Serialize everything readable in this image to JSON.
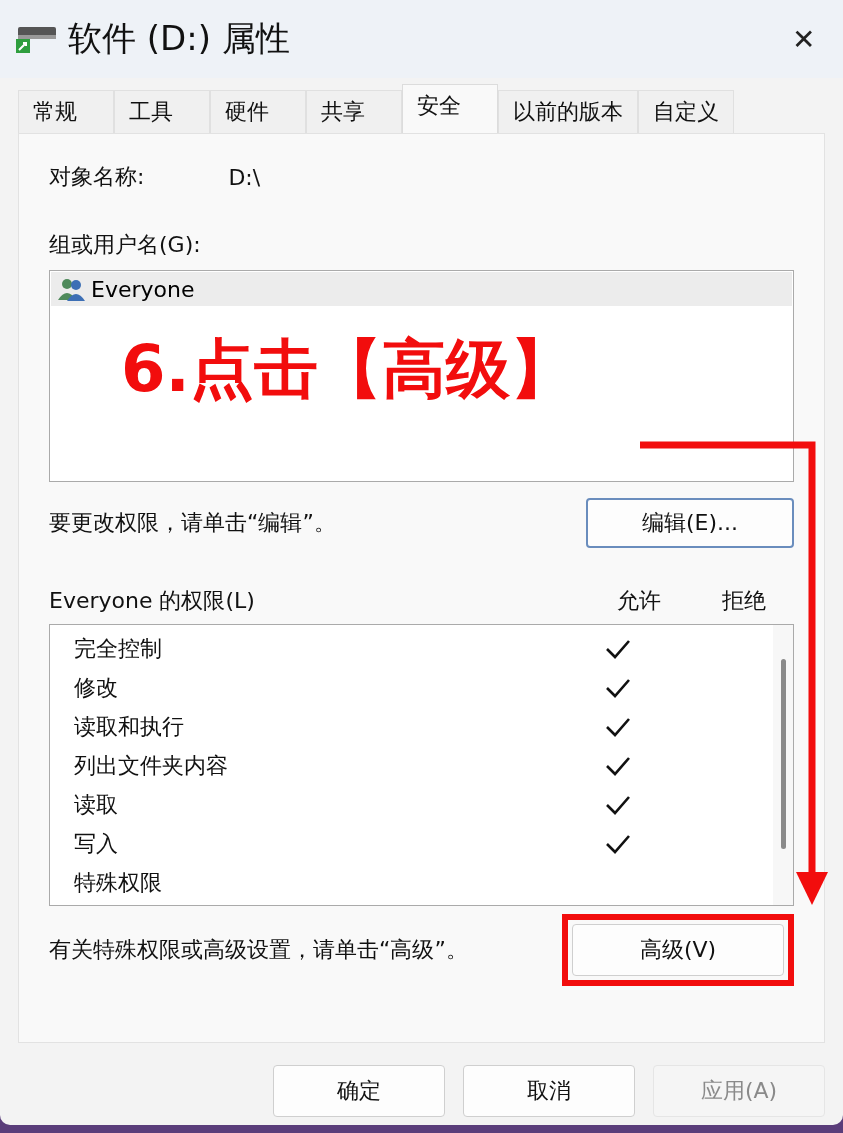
{
  "window": {
    "title": "软件 (D:) 属性",
    "close": "✕"
  },
  "tabs": [
    {
      "label": "常规",
      "selected": false
    },
    {
      "label": "工具",
      "selected": false
    },
    {
      "label": "硬件",
      "selected": false
    },
    {
      "label": "共享",
      "selected": false
    },
    {
      "label": "安全",
      "selected": true
    },
    {
      "label": "以前的版本",
      "selected": false
    },
    {
      "label": "自定义",
      "selected": false
    }
  ],
  "object_name": {
    "label": "对象名称:",
    "value": "D:\\"
  },
  "groups": {
    "label": "组或用户名(G):",
    "items": [
      {
        "name": "Everyone",
        "selected": true
      }
    ]
  },
  "edit_hint": "要更改权限，请单击“编辑”。",
  "edit_button": "编辑(E)...",
  "permissions": {
    "label": "Everyone 的权限(L)",
    "allow_header": "允许",
    "deny_header": "拒绝",
    "rows": [
      {
        "name": "完全控制",
        "allow": true,
        "deny": false
      },
      {
        "name": "修改",
        "allow": true,
        "deny": false
      },
      {
        "name": "读取和执行",
        "allow": true,
        "deny": false
      },
      {
        "name": "列出文件夹内容",
        "allow": true,
        "deny": false
      },
      {
        "name": "读取",
        "allow": true,
        "deny": false
      },
      {
        "name": "写入",
        "allow": true,
        "deny": false
      },
      {
        "name": "特殊权限",
        "allow": false,
        "deny": false
      }
    ]
  },
  "advanced_hint": "有关特殊权限或高级设置，请单击“高级”。",
  "advanced_button": "高级(V)",
  "annotation": {
    "text": "6.点击【高级】"
  },
  "buttons": [
    {
      "label": "确定",
      "disabled": false
    },
    {
      "label": "取消",
      "disabled": false
    },
    {
      "label": "应用(A)",
      "disabled": true
    }
  ]
}
